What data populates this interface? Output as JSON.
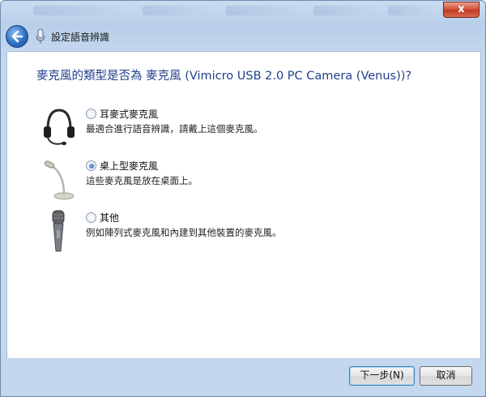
{
  "window": {
    "close_glyph": "x"
  },
  "nav": {
    "title": "設定語音辨識",
    "back_icon": "back-arrow-icon",
    "mic_icon": "microphone-icon"
  },
  "main": {
    "heading": "麥克風的類型是否為 麥克風 (Vimicro USB 2.0 PC Camera (Venus))?",
    "options": [
      {
        "label": "耳麥式麥克風",
        "description": "最適合進行語音辨識，請戴上這個麥克風。",
        "checked": false,
        "icon": "headset-icon"
      },
      {
        "label": "桌上型麥克風",
        "description": "這些麥克風是放在桌面上。",
        "checked": true,
        "icon": "desktop-microphone-icon"
      },
      {
        "label": "其他",
        "description": "例如陣列式麥克風和內建到其他裝置的麥克風。",
        "checked": false,
        "icon": "handheld-microphone-icon"
      }
    ]
  },
  "footer": {
    "next_label": "下一步(N)",
    "cancel_label": "取消"
  },
  "colors": {
    "heading": "#1f3f8c",
    "chrome": "#c3d7ee",
    "close": "#c23a22"
  }
}
